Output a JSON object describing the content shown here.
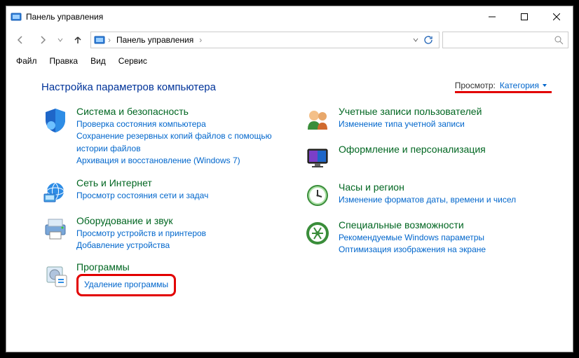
{
  "window": {
    "title": "Панель управления"
  },
  "breadcrumb": {
    "root": "Панель управления"
  },
  "menu": {
    "file": "Файл",
    "edit": "Правка",
    "view": "Вид",
    "tools": "Сервис"
  },
  "heading": "Настройка параметров компьютера",
  "view_by": {
    "label": "Просмотр:",
    "value": "Категория"
  },
  "left": [
    {
      "title": "Система и безопасность",
      "links": [
        "Проверка состояния компьютера",
        "Сохранение резервных копий файлов с помощью истории файлов",
        "Архивация и восстановление (Windows 7)"
      ]
    },
    {
      "title": "Сеть и Интернет",
      "links": [
        "Просмотр состояния сети и задач"
      ]
    },
    {
      "title": "Оборудование и звук",
      "links": [
        "Просмотр устройств и принтеров",
        "Добавление устройства"
      ]
    },
    {
      "title": "Программы",
      "links": [
        "Удаление программы"
      ]
    }
  ],
  "right": [
    {
      "title": "Учетные записи пользователей",
      "links": [
        "Изменение типа учетной записи"
      ]
    },
    {
      "title": "Оформление и персонализация",
      "links": []
    },
    {
      "title": "Часы и регион",
      "links": [
        "Изменение форматов даты, времени и чисел"
      ]
    },
    {
      "title": "Специальные возможности",
      "links": [
        "Рекомендуемые Windows параметры",
        "Оптимизация изображения на экране"
      ]
    }
  ]
}
